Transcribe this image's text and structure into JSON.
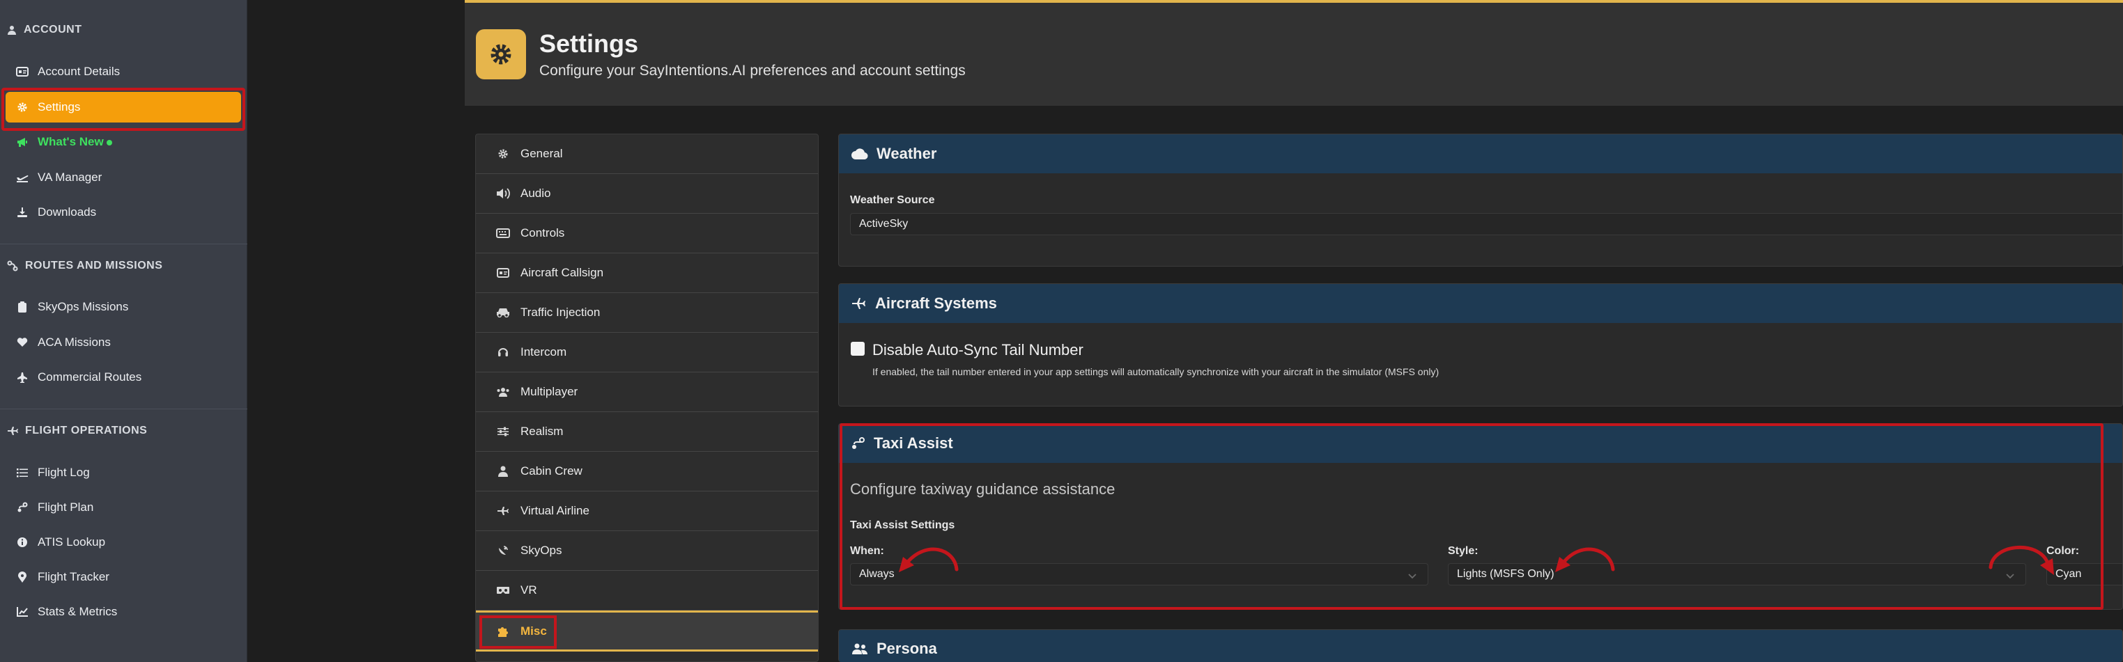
{
  "sidebar": {
    "sections": [
      {
        "label": "ACCOUNT",
        "icon": "user-icon"
      },
      {
        "label": "ROUTES AND MISSIONS",
        "icon": "route-icon"
      },
      {
        "label": "FLIGHT OPERATIONS",
        "icon": "plane-icon"
      }
    ],
    "items": {
      "account_details": "Account Details",
      "settings": "Settings",
      "whats_new": "What's New",
      "va_manager": "VA Manager",
      "downloads": "Downloads",
      "skyops_missions": "SkyOps Missions",
      "aca_missions": "ACA Missions",
      "commercial_routes": "Commercial Routes",
      "flight_log": "Flight Log",
      "flight_plan": "Flight Plan",
      "atis_lookup": "ATIS Lookup",
      "flight_tracker": "Flight Tracker",
      "stats_metrics": "Stats & Metrics"
    }
  },
  "header": {
    "title": "Settings",
    "subtitle": "Configure your SayIntentions.AI preferences and account settings"
  },
  "nav": {
    "items": [
      "General",
      "Audio",
      "Controls",
      "Aircraft Callsign",
      "Traffic Injection",
      "Intercom",
      "Multiplayer",
      "Realism",
      "Cabin Crew",
      "Virtual Airline",
      "SkyOps",
      "VR",
      "Misc"
    ],
    "active": "Misc"
  },
  "weather": {
    "title": "Weather",
    "source_label": "Weather Source",
    "source_value": "ActiveSky"
  },
  "aircraft_systems": {
    "title": "Aircraft Systems",
    "option_label": "Disable Auto-Sync Tail Number",
    "option_help": "If enabled, the tail number entered in your app settings will automatically synchronize with your aircraft in the simulator (MSFS only)"
  },
  "taxi_assist": {
    "title": "Taxi Assist",
    "description": "Configure taxiway guidance assistance",
    "settings_label": "Taxi Assist Settings",
    "when_label": "When:",
    "when_value": "Always",
    "style_label": "Style:",
    "style_value": "Lights (MSFS Only)",
    "color_label": "Color:",
    "color_value": "Cyan"
  },
  "persona": {
    "title": "Persona"
  },
  "colors": {
    "accent": "#f59e0b",
    "highlight": "#c4161c",
    "card_header": "#1e3a53",
    "new_green": "#3ee05f"
  }
}
